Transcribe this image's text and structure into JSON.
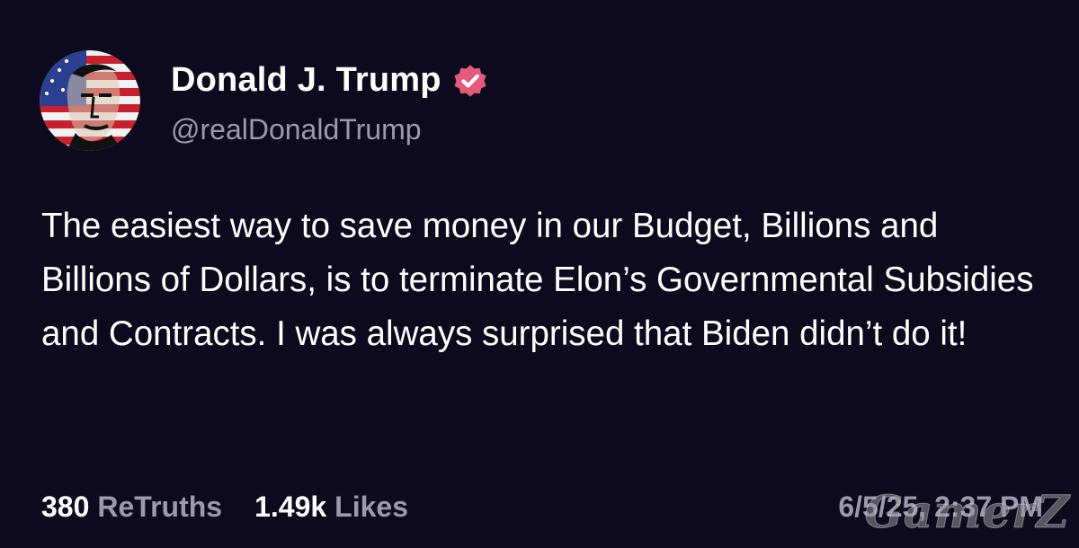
{
  "author": {
    "name": "Donald J. Trump",
    "handle": "@realDonaldTrump",
    "verified_icon": "verified-badge-icon",
    "avatar": "avatar-flag-portrait"
  },
  "post": {
    "text": "The easiest way to save money in our Budget, Billions and Billions of Dollars, is to terminate Elon’s Governmental Subsidies and Contracts. I was always surprised that Biden didn’t do it!"
  },
  "stats": {
    "retruths_count": "380",
    "retruths_label": "ReTruths",
    "likes_count": "1.49k",
    "likes_label": "Likes"
  },
  "timestamp": "6/5/25, 2:37 PM",
  "watermark": "GamerZ",
  "colors": {
    "background": "#0d0a1d",
    "text_primary": "#ffffff",
    "text_secondary": "#9c98ae",
    "verified_badge": "#e45a7c"
  }
}
